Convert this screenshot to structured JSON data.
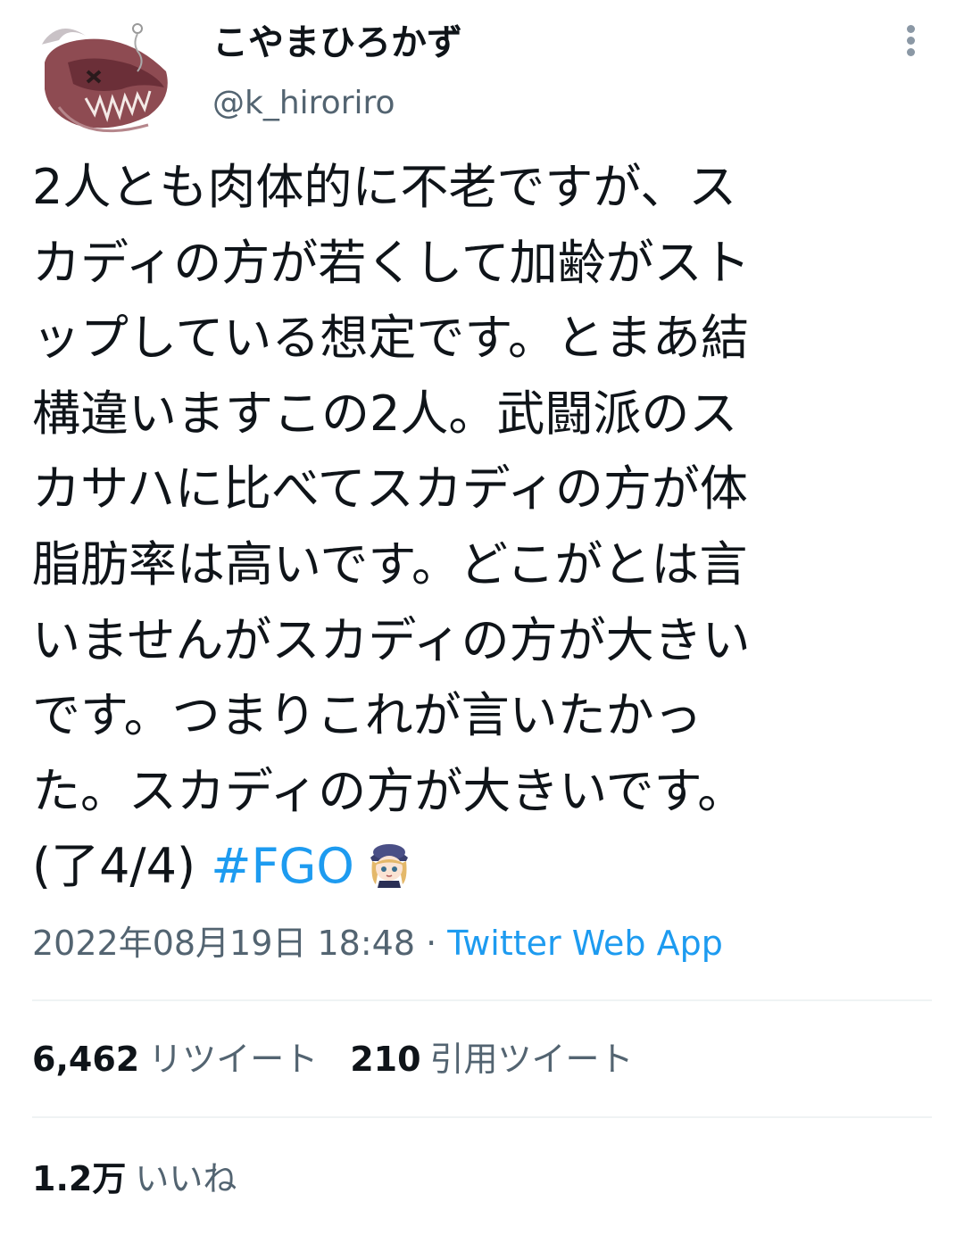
{
  "author": {
    "display_name": "こやまひろかず",
    "handle": "@k_hiroriro"
  },
  "tweet": {
    "lines": [
      "2人とも肉体的に不老ですが、ス",
      "カディの方が若くして加齢がスト",
      "ップしている想定です。とまあ結",
      "構違いますこの2人。武闘派のス",
      "カサハに比べてスカディの方が体",
      "脂肪率は高いです。どこがとは言",
      "いませんがスカディの方が大きい",
      "です。つまりこれが言いたかっ",
      "た。スカディの方が大きいです。"
    ],
    "last_line_prefix": "(了4/4) ",
    "hashtag": "#FGO"
  },
  "meta": {
    "timestamp": "2022年08月19日 18:48",
    "separator": " · ",
    "source": "Twitter Web App"
  },
  "stats": {
    "retweets_count": "6,462",
    "retweets_label": "リツイート",
    "quotes_count": "210",
    "quotes_label": "引用ツイート",
    "likes_count": "1.2万",
    "likes_label": "いいね"
  },
  "colors": {
    "text": "#0f1419",
    "secondary": "#536471",
    "link": "#1d9bf0",
    "divider": "#eff3f4"
  },
  "icons": [
    "avatar-image",
    "more-options-icon",
    "character-emoji-icon"
  ]
}
